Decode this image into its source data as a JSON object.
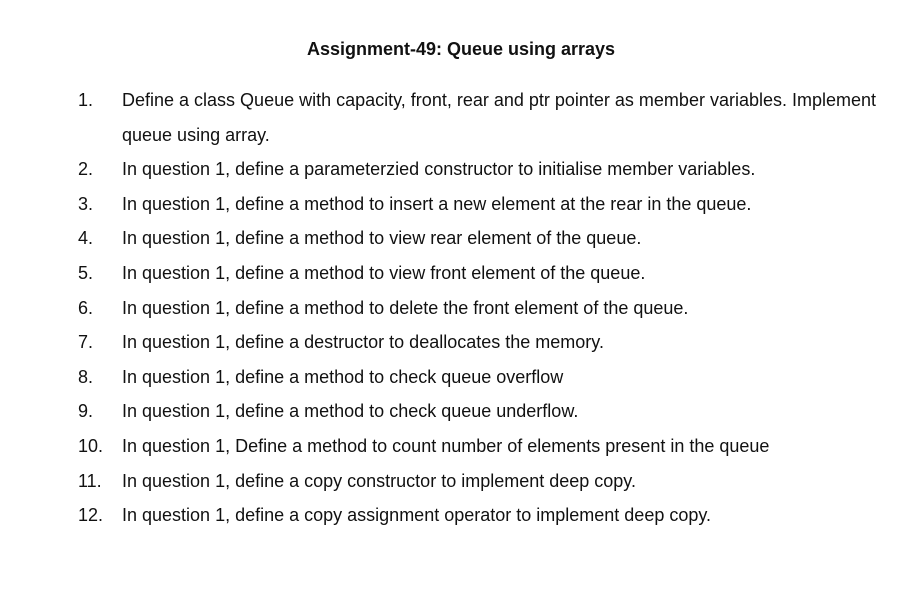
{
  "document": {
    "title": "Assignment-49: Queue using arrays",
    "items": [
      {
        "number": "1.",
        "text": "Define a class Queue with capacity, front, rear and ptr pointer as member variables. Implement queue using array."
      },
      {
        "number": "2.",
        "text": "In question 1, define a parameterzied constructor to initialise member variables."
      },
      {
        "number": "3.",
        "text": "In question 1, define a method to insert a new element at the rear in the queue."
      },
      {
        "number": "4.",
        "text": "In question 1, define a method to view rear element of the queue."
      },
      {
        "number": "5.",
        "text": "In question 1, define a method to view front element of the queue."
      },
      {
        "number": "6.",
        "text": "In question 1, define a method to delete the front element of the queue."
      },
      {
        "number": "7.",
        "text": "In question 1, define a destructor to deallocates the memory."
      },
      {
        "number": "8.",
        "text": "In question 1, define a method to check queue overflow"
      },
      {
        "number": "9.",
        "text": "In question 1, define a method to check queue underflow."
      },
      {
        "number": "10.",
        "text": "In question 1, Define a method to count number of elements present in the queue"
      },
      {
        "number": "11.",
        "text": "In question 1, define a copy constructor to implement deep copy."
      },
      {
        "number": "12.",
        "text": "In question 1, define a copy assignment operator to implement deep copy."
      }
    ]
  }
}
